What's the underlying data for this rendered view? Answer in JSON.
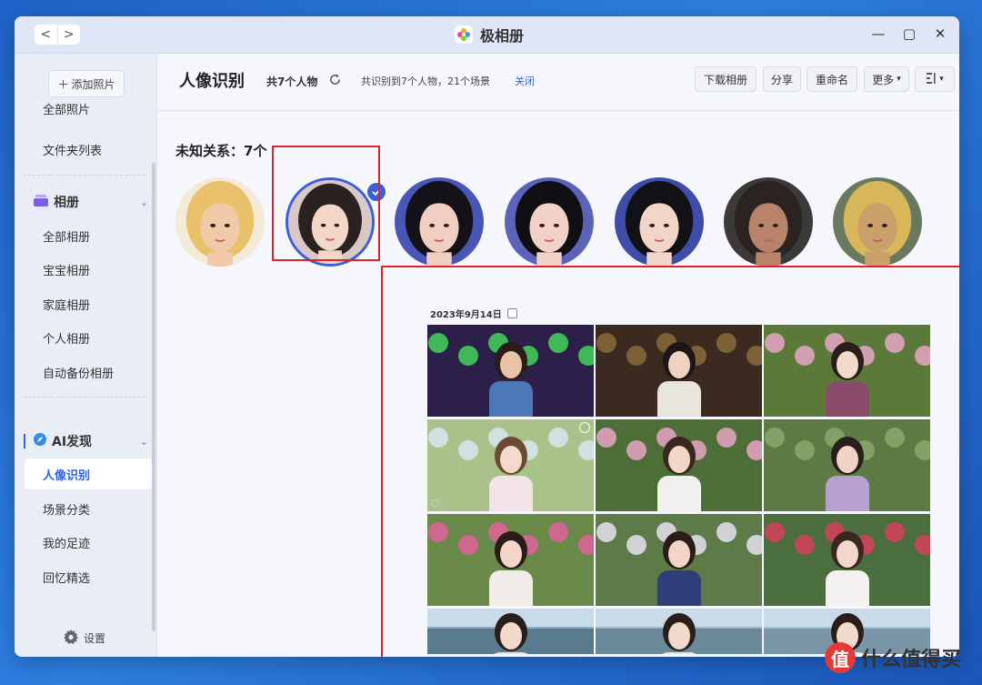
{
  "window": {
    "title": "极相册",
    "nav_back": "<",
    "nav_forward": ">",
    "controls": {
      "minimize": "—",
      "maximize": "▢",
      "close": "✕"
    }
  },
  "sidebar": {
    "add_button": "添加照片",
    "items_top": [
      {
        "label": "全部照片"
      },
      {
        "label": "文件夹列表"
      }
    ],
    "albums": {
      "header": "相册",
      "items": [
        {
          "label": "全部相册"
        },
        {
          "label": "宝宝相册"
        },
        {
          "label": "家庭相册"
        },
        {
          "label": "个人相册"
        },
        {
          "label": "自动备份相册"
        }
      ]
    },
    "ai": {
      "header": "AI发现",
      "items": [
        {
          "label": "人像识别",
          "active": true
        },
        {
          "label": "场景分类"
        },
        {
          "label": "我的足迹"
        },
        {
          "label": "回忆精选"
        }
      ]
    },
    "settings": "设置"
  },
  "toolbar": {
    "title": "人像识别",
    "people_count": "共7个人物",
    "summary": "共识别到7个人物，21个场景",
    "close_link": "关闭",
    "buttons": {
      "download": "下载相册",
      "share": "分享",
      "rename": "重命名",
      "more": "更多"
    }
  },
  "people": {
    "section_title": "未知关系：7个",
    "faces": [
      {
        "name": "face-1",
        "hair": "#e9c16a",
        "skin": "#f0c9a8",
        "bg": "#f3ead8"
      },
      {
        "name": "face-2",
        "hair": "#2a2220",
        "skin": "#f4d6c6",
        "bg": "#d9c8c6",
        "selected": true
      },
      {
        "name": "face-3",
        "hair": "#141218",
        "skin": "#f0cfc0",
        "bg": "#4a56b5"
      },
      {
        "name": "face-4",
        "hair": "#101014",
        "skin": "#f2d2c6",
        "bg": "#5a63b8"
      },
      {
        "name": "face-5",
        "hair": "#121216",
        "skin": "#f3d5c8",
        "bg": "#3f4ca8"
      },
      {
        "name": "face-6",
        "hair": "#2a2320",
        "skin": "#b9826a",
        "bg": "#3c3a38"
      },
      {
        "name": "face-7",
        "hair": "#d8b75a",
        "skin": "#c9a06a",
        "bg": "#6b7860"
      }
    ]
  },
  "gallery": {
    "date": "2023年9月14日",
    "photos": [
      {
        "bg": "#2c1f4a",
        "accent": "#43d35a",
        "skin": "#e9c2a8",
        "hair": "#2a1c18",
        "outfit": "#4d78b8"
      },
      {
        "bg": "#3b2a20",
        "accent": "#8a6a3a",
        "skin": "#f0d2c2",
        "hair": "#1e1614",
        "outfit": "#e8e4de"
      },
      {
        "bg": "#5b7a3a",
        "accent": "#e6a6c8",
        "skin": "#f3d8cc",
        "hair": "#2a1e1a",
        "outfit": "#8a4b6a"
      },
      {
        "bg": "#a9c28a",
        "accent": "#d8e6ee",
        "skin": "#f4d9cc",
        "hair": "#6b4a32",
        "outfit": "#f1e3e6"
      },
      {
        "bg": "#4e6e38",
        "accent": "#e9a4c6",
        "skin": "#f3d6c8",
        "hair": "#3a2820",
        "outfit": "#f2f0ee"
      },
      {
        "bg": "#5d7a44",
        "accent": "#8aa86a",
        "skin": "#f2d4c6",
        "hair": "#2a1e1a",
        "outfit": "#b8a0d0"
      },
      {
        "bg": "#6a8a4a",
        "accent": "#e0609a",
        "skin": "#f3d6c9",
        "hair": "#2a1c18",
        "outfit": "#f2ece8"
      },
      {
        "bg": "#5d7a48",
        "accent": "#e6e2f0",
        "skin": "#f2d5c8",
        "hair": "#2a1c18",
        "outfit": "#2f3f7a"
      },
      {
        "bg": "#4a6e3e",
        "accent": "#d8405a",
        "skin": "#f3d7ca",
        "hair": "#3a2820",
        "outfit": "#f4f2f0"
      },
      {
        "bg": "#8fb0c8",
        "accent": "#5a7a8e",
        "skin": "#f3d8cc",
        "hair": "#2a1e1a",
        "outfit": "#e8e4e0"
      },
      {
        "bg": "#9cb8cc",
        "accent": "#6a8a9a",
        "skin": "#f3d8cc",
        "hair": "#2a1e1a",
        "outfit": "#e8e4e0"
      },
      {
        "bg": "#a8c2d2",
        "accent": "#7a96a6",
        "skin": "#f3d8cc",
        "hair": "#2a1e1a",
        "outfit": "#e8e4e0"
      }
    ]
  },
  "watermark": {
    "text": "值 什么值得买"
  },
  "colors": {
    "accent": "#2f62e8",
    "highlight": "#e0222b"
  }
}
